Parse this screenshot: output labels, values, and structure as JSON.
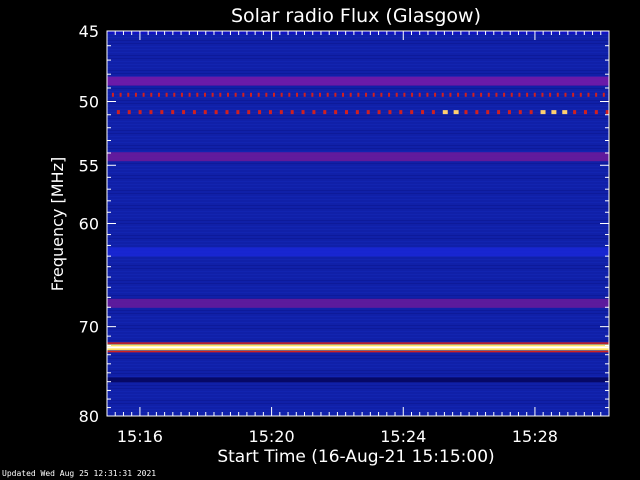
{
  "chart_data": {
    "type": "heatmap",
    "title": "Solar radio Flux (Glasgow)",
    "xlabel": "Start Time (16-Aug-21 15:15:00)",
    "ylabel": "Frequency [MHz]",
    "x_ticks": [
      "15:16",
      "15:20",
      "15:24",
      "15:28"
    ],
    "x_tick_minutes": [
      1,
      5,
      9,
      13
    ],
    "xlim_minutes": [
      0,
      15.25
    ],
    "y_ticks": [
      45,
      50,
      55,
      60,
      70,
      80
    ],
    "ylim": [
      45,
      80
    ],
    "scale": "log",
    "bands": [
      {
        "freq": 45.0,
        "intensity": "high",
        "color": "#1010c8"
      },
      {
        "freq": 48.5,
        "intensity": "elevated",
        "color": "#7a1aa8"
      },
      {
        "freq": 54.3,
        "intensity": "elevated",
        "color": "#701a9a"
      },
      {
        "freq": 62.6,
        "intensity": "elevated",
        "color": "#1a28d8"
      },
      {
        "freq": 67.6,
        "intensity": "elevated",
        "color": "#6a1a9a"
      },
      {
        "freq": 72.2,
        "intensity": "saturated",
        "color": "#ffe060"
      },
      {
        "freq": 75.8,
        "intensity": "low",
        "color": "#05055a"
      }
    ],
    "bursts_freq": [
      49.5,
      50.8
    ],
    "colors": {
      "background": "#1020a8",
      "axes": "#ffffff",
      "burst_hot": "#ffd070",
      "burst_warm": "#d02020"
    }
  },
  "footer": "Updated Wed Aug 25 12:31:31 2021"
}
